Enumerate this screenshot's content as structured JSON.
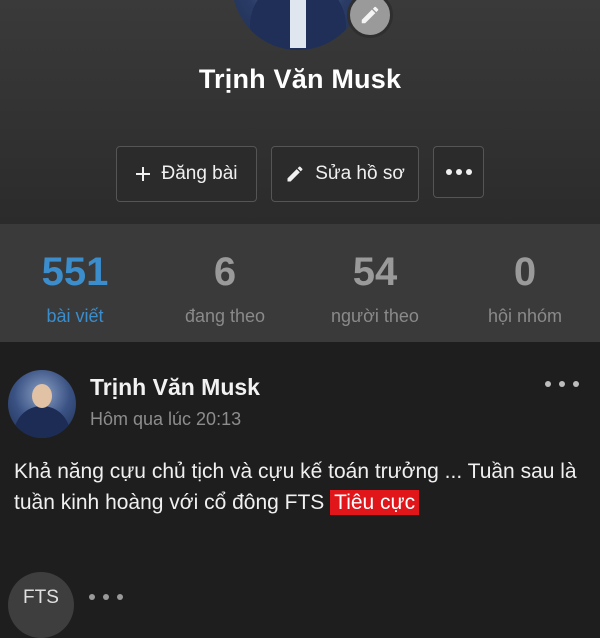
{
  "profile": {
    "name": "Trịnh Văn Musk"
  },
  "actions": {
    "post_label": "Đăng bài",
    "edit_label": "Sửa hồ sơ"
  },
  "stats": [
    {
      "value": "551",
      "label": "bài viết",
      "active": true
    },
    {
      "value": "6",
      "label": "đang theo",
      "active": false
    },
    {
      "value": "54",
      "label": "người theo",
      "active": false
    },
    {
      "value": "0",
      "label": "hội nhóm",
      "active": false
    }
  ],
  "post": {
    "author": "Trịnh Văn Musk",
    "time": "Hôm qua lúc 20:13",
    "text": "Khả năng cựu chủ tịch và cựu kế toán trưởng ... Tuần sau là tuần kinh hoàng với cổ đông FTS ",
    "tag": "Tiêu cực"
  },
  "next_post": {
    "avatar_text": "FTS"
  },
  "colors": {
    "accent": "#3b8dcc",
    "tag_red": "#e0161a",
    "background": "#1e1e1e"
  },
  "icons": [
    "edit-pencil-icon",
    "plus-icon",
    "pencil-icon",
    "more-icon"
  ]
}
